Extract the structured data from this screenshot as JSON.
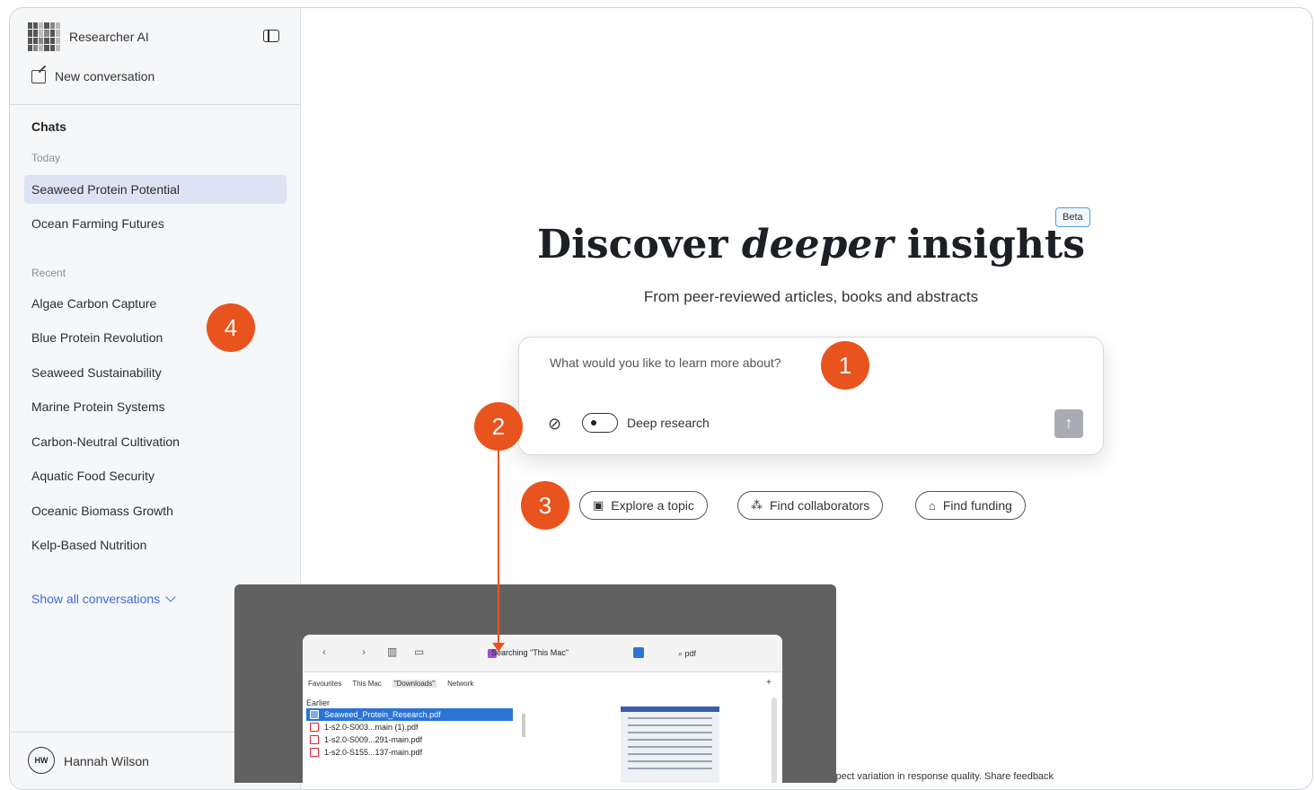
{
  "sidebar": {
    "app_title": "Researcher AI",
    "new_conversation": "New conversation",
    "chats_title": "Chats",
    "today_label": "Today",
    "today_items": [
      "Seaweed Protein Potential",
      "Ocean Farming Futures"
    ],
    "recent_label": "Recent",
    "recent_items": [
      "Algae Carbon Capture",
      "Blue Protein Revolution",
      "Seaweed Sustainability",
      "Marine Protein Systems",
      "Carbon-Neutral Cultivation",
      "Aquatic Food Security",
      "Oceanic Biomass Growth",
      "Kelp-Based Nutrition"
    ],
    "show_all": "Show all conversations",
    "user_initials": "HW",
    "user_name": "Hannah Wilson"
  },
  "main": {
    "beta_badge": "Beta",
    "headline_pre": "Discover",
    "headline_em": "deeper",
    "headline_post": "insights",
    "subline": "From peer-reviewed articles, books and abstracts",
    "prompt_placeholder": "What would you like to learn more about?",
    "deep_research_label": "Deep research",
    "chips": [
      "Explore a topic",
      "Find collaborators",
      "Find funding"
    ],
    "footer_note": "xpect variation in response quality. Share feedback"
  },
  "callouts": [
    "1",
    "2",
    "3",
    "4"
  ],
  "finder": {
    "search_title": "Searching \"This Mac\"",
    "search_query": "pdf",
    "tabs": [
      "Favourites",
      "This Mac",
      "\"Downloads\"",
      "Network"
    ],
    "group": "Earlier",
    "files": [
      "Seaweed_Protein_Research.pdf",
      "1-s2.0-S003...main (1).pdf",
      "1-s2.0-S009...291-main.pdf",
      "1-s2.0-S155...137-main.pdf"
    ]
  },
  "colors": {
    "accent": "#e8531e",
    "active_item": "#dde3f5",
    "link": "#3c6bd8",
    "beta_border": "#4a9fd8"
  }
}
